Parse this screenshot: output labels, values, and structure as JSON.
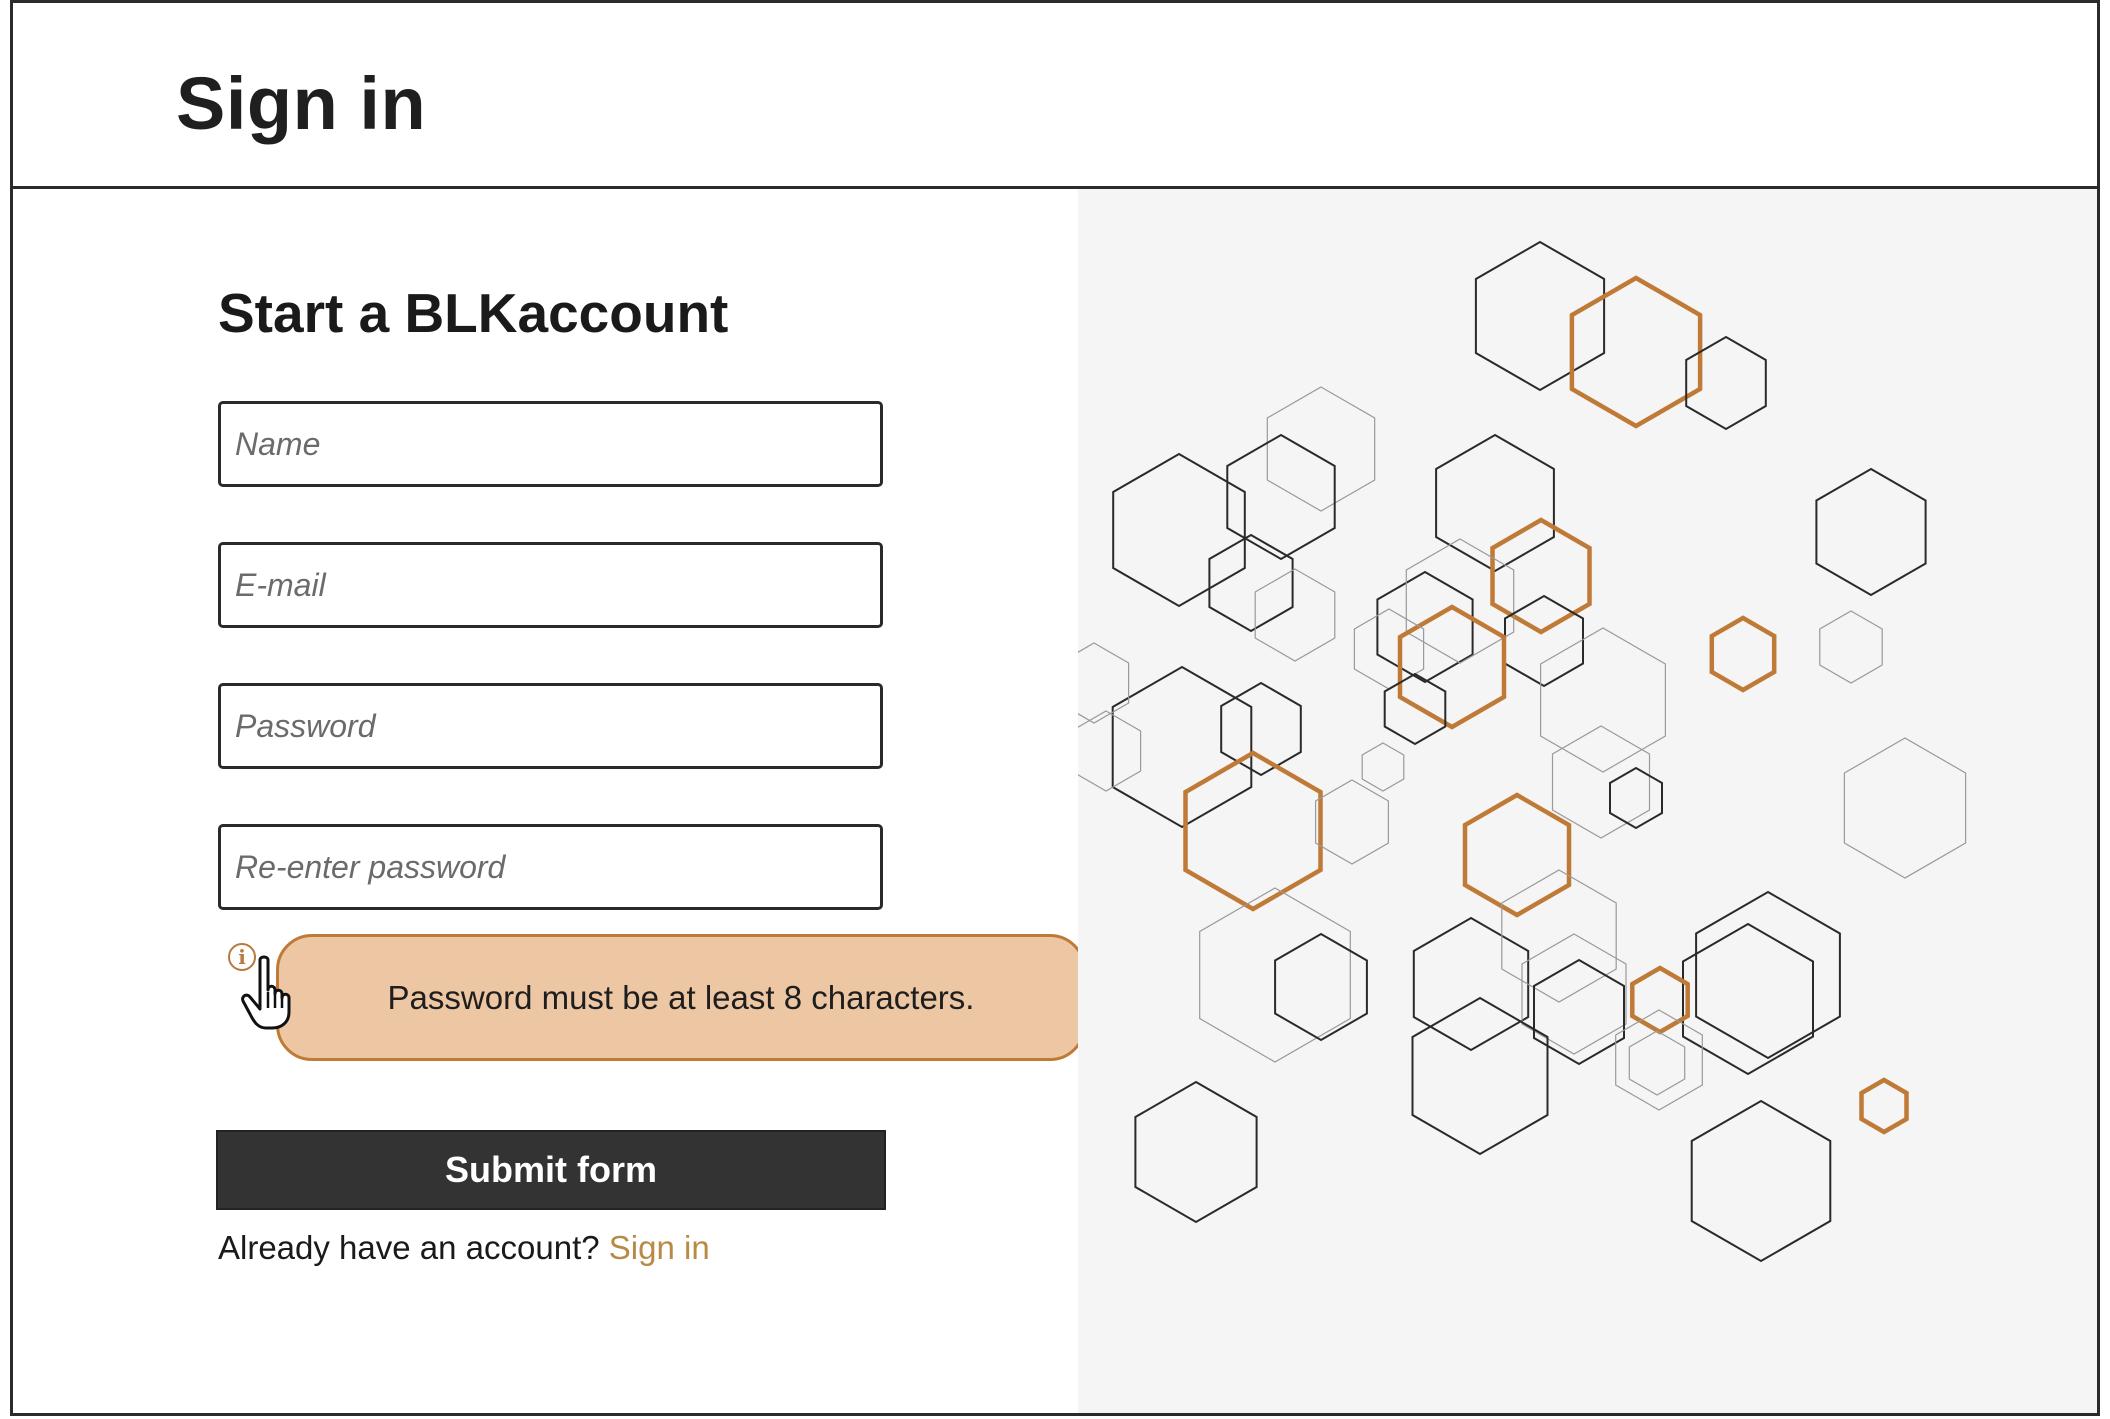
{
  "header": {
    "title": "Sign in"
  },
  "form": {
    "title": "Start a BLKaccount",
    "fields": [
      {
        "placeholder": "Name",
        "value": ""
      },
      {
        "placeholder": "E-mail",
        "value": ""
      },
      {
        "placeholder": "Password",
        "value": ""
      },
      {
        "placeholder": "Re-enter password",
        "value": ""
      }
    ],
    "tooltip": "Password must be at least 8 characters.",
    "submit_label": "Submit form",
    "signin_prompt": "Already have an account?",
    "signin_link": "Sign in"
  },
  "icons": {
    "info": "info-circle-icon",
    "cursor": "hand-pointer-icon"
  },
  "colors": {
    "accent": "#c07a37",
    "tooltip_bg": "#edc6a3",
    "link": "#b88a45",
    "button_bg": "#333333",
    "art_bg": "#f5f5f5"
  }
}
